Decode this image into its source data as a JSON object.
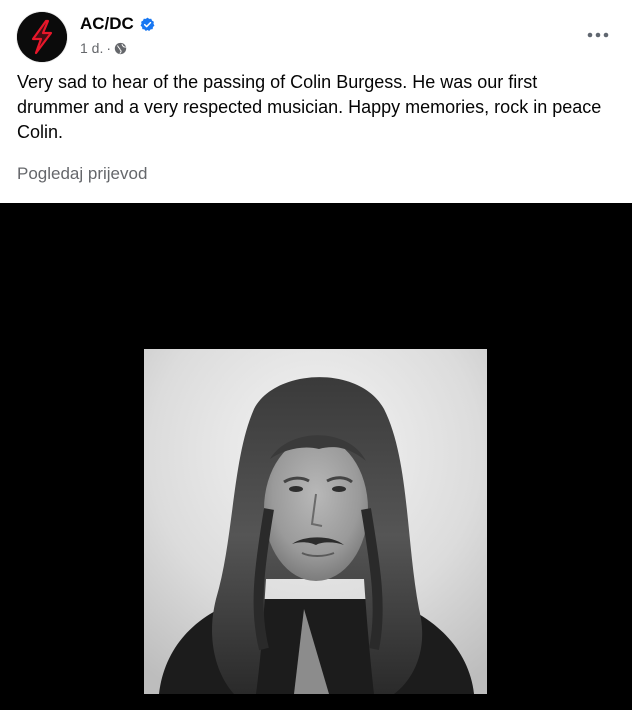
{
  "post": {
    "author": "AC/DC",
    "timestamp": "1 d.",
    "meta_separator": "·",
    "audience_icon": "globe-icon",
    "verified_icon": "verified-badge-icon",
    "text": "Very sad to hear of the passing of Colin Burgess. He was our first drummer and a very respected musician. Happy memories, rock in peace Colin.",
    "translate_label": "Pogledaj prijevod"
  },
  "colors": {
    "verified_badge": "#1877f2",
    "secondary_text": "#65676b",
    "media_background": "#000000",
    "avatar_bolt": "#e8172a"
  }
}
